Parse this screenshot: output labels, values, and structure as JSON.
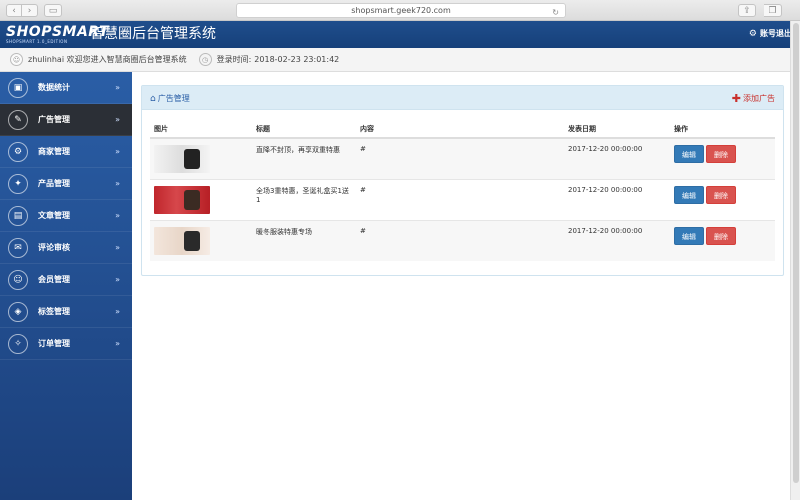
{
  "browser": {
    "url": "shopsmart.geek720.com",
    "back_icon": "chevron-left-icon",
    "forward_icon": "chevron-right-icon",
    "reload_icon": "reload-icon"
  },
  "header": {
    "logo": "SHOPSMART",
    "logo_sub": "SHOPSMART 1.0_EDITION",
    "title": "智慧圈后台管理系统",
    "logout_label": "账号退出"
  },
  "info": {
    "welcome": "zhulinhai 欢迎您进入智慧商圈后台管理系统",
    "login_time_label": "登录时间:",
    "login_time": "2018-02-23 23:01:42"
  },
  "sidebar": {
    "items": [
      {
        "label": "数据统计",
        "icon": "chart-icon",
        "glyph": "▣"
      },
      {
        "label": "广告管理",
        "icon": "ad-icon",
        "glyph": "✎"
      },
      {
        "label": "商家管理",
        "icon": "merchant-icon",
        "glyph": "⚙"
      },
      {
        "label": "产品管理",
        "icon": "product-icon",
        "glyph": "✦"
      },
      {
        "label": "文章管理",
        "icon": "article-icon",
        "glyph": "▤"
      },
      {
        "label": "评论审核",
        "icon": "comment-icon",
        "glyph": "✉"
      },
      {
        "label": "会员管理",
        "icon": "member-icon",
        "glyph": "☺"
      },
      {
        "label": "标签管理",
        "icon": "tag-icon",
        "glyph": "◈"
      },
      {
        "label": "订单管理",
        "icon": "order-icon",
        "glyph": "✧"
      }
    ],
    "arrow": "»"
  },
  "panel": {
    "title": "广告管理",
    "add_label": "添加广告",
    "columns": [
      "图片",
      "标题",
      "内容",
      "发表日期",
      "操作"
    ],
    "rows": [
      {
        "title": "直降不封顶，再享双重特惠",
        "content": "#",
        "date": "2017-12-20 00:00:00"
      },
      {
        "title": "全场3重特惠，圣诞礼盒买1送1",
        "content": "#",
        "date": "2017-12-20 00:00:00"
      },
      {
        "title": "暖冬服装特惠专场",
        "content": "#",
        "date": "2017-12-20 00:00:00"
      }
    ],
    "edit_label": "编辑",
    "delete_label": "删除"
  }
}
